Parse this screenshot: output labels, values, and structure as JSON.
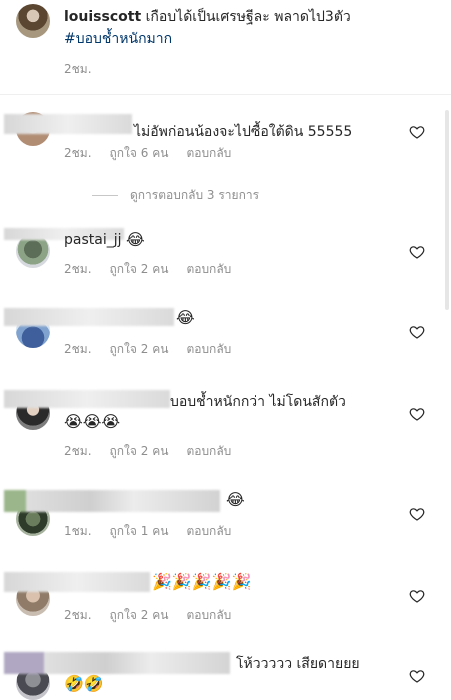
{
  "post": {
    "username": "louisscott",
    "caption": " เกือบได้เป็นเศรษฐีละ พลาดไป3ตัว",
    "hashtag": "#บอบช้ำหนักมาก",
    "time": "2ชม."
  },
  "view_replies": "ดูการตอบกลับ 3 รายการ",
  "reply_label": "ตอบกลับ",
  "comments": [
    {
      "text": "ไม่อัพก่อนน้องจะไปซื้อใต้ดิน 55555",
      "time": "2ชม.",
      "likes": "ถูกใจ 6 คน"
    },
    {
      "text": "pastai_jj",
      "emoji": "😂",
      "time": "2ชม.",
      "likes": "ถูกใจ 2 คน"
    },
    {
      "text": "",
      "emoji": "😂",
      "time": "2ชม.",
      "likes": "ถูกใจ 2 คน"
    },
    {
      "text": "บอบช้ำหนักกว่า ไม่โดนสักตัว",
      "emoji": "😭😭😭",
      "time": "2ชม.",
      "likes": "ถูกใจ 2 คน"
    },
    {
      "text": "",
      "emoji": "😂",
      "time": "1ชม.",
      "likes": "ถูกใจ 1 คน"
    },
    {
      "text": "",
      "emoji": "🎉🎉🎉🎉🎉",
      "time": "2ชม.",
      "likes": "ถูกใจ 2 คน"
    },
    {
      "text": "โห้ววววว เสียดายยย",
      "emoji": "🤣🤣",
      "time": "",
      "likes": ""
    }
  ],
  "icons": {
    "heart": "heart-outline-icon",
    "avatar": "avatar"
  }
}
